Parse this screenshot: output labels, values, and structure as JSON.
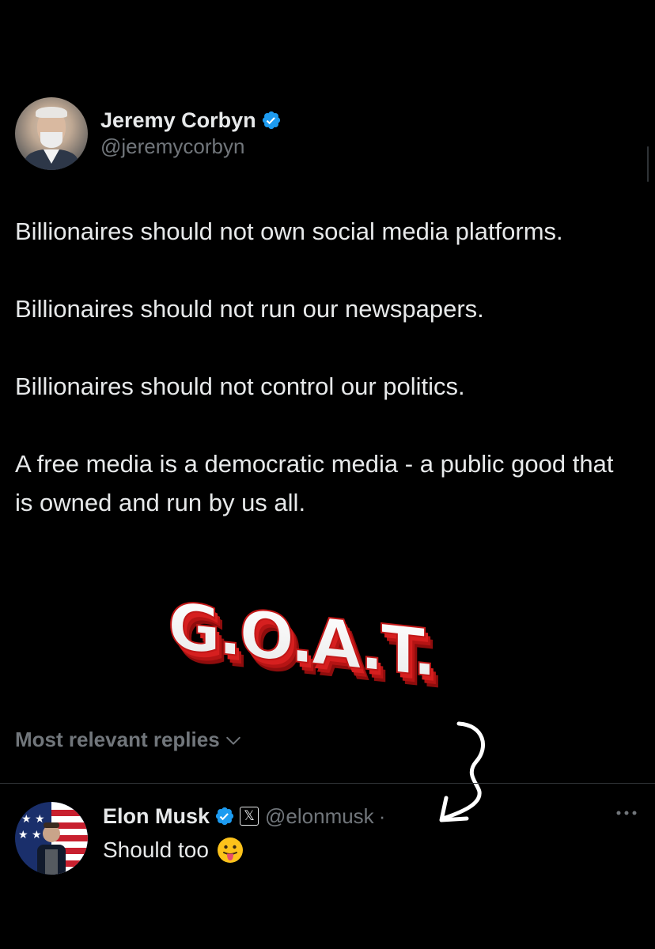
{
  "tweet": {
    "author": {
      "display_name": "Jeremy Corbyn",
      "handle": "@jeremycorbyn",
      "verified": true
    },
    "paragraphs": [
      "Billionaires should not own social media platforms.",
      "Billionaires should not run our newspapers.",
      "Billionaires should not control our politics.",
      "A free media is a democratic media - a public good that is owned and run by us all."
    ]
  },
  "sticker": {
    "text": "G.O.A.T."
  },
  "replies": {
    "sort_label": "Most relevant replies",
    "items": [
      {
        "display_name": "Elon Musk",
        "verified": true,
        "affiliate_badge": "𝕏",
        "handle": "@elonmusk",
        "separator": "·",
        "text": "Should too",
        "emoji": "face-with-tongue-icon"
      }
    ]
  },
  "colors": {
    "background": "#000000",
    "primary_text": "#e7e9ea",
    "secondary_text": "#71767b",
    "verified_blue": "#1d9bf0",
    "divider": "#2f3336",
    "sticker_red": "#d61f1f"
  }
}
